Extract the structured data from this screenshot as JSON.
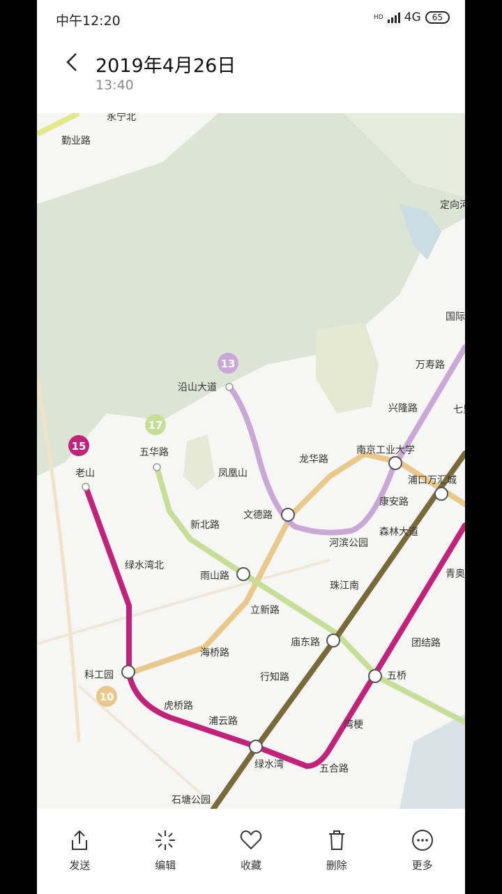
{
  "status": {
    "time": "中午12:20",
    "network": "4G",
    "hd": "HD",
    "battery": "65"
  },
  "header": {
    "title": "2019年4月26日",
    "subtitle": "13:40"
  },
  "map": {
    "line_badges": [
      "13",
      "17",
      "15",
      "10"
    ],
    "stations": {
      "yongning_bei": "永宁北",
      "qinye_lu": "勤业路",
      "dingxiang": "定向河",
      "guoji": "国际",
      "wanshou_lu": "万寿路",
      "xinglong_lu": "兴隆路",
      "qi": "七里",
      "yanshan_dadao": "沿山大道",
      "wuhua_lu": "五华路",
      "laoshan": "老山",
      "fenghuang_shan": "凤凰山",
      "longhua_lu": "龙华路",
      "nanjing_gongye": "南京工业大学",
      "pukou_wanhui": "浦口万汇城",
      "kangan_lu": "康安路",
      "wende_lu": "文德路",
      "xinbei_lu": "新北路",
      "hebin_gongyuan": "河滨公园",
      "senlin_dadao": "森林大道",
      "lvshuiwan_bei": "绿水湾北",
      "yushan_lu": "雨山路",
      "zhujiang_nan": "珠江南",
      "qingao": "青奥",
      "lixin_lu": "立新路",
      "haiqiao_lu": "海桥路",
      "miaodong_lu": "庙东路",
      "tuanjie_lu": "团结路",
      "kegongyuan": "科工园",
      "xingzhi_lu": "行知路",
      "wuqiao": "五桥",
      "huqiao_lu": "虎桥路",
      "puyun_lu": "浦云路",
      "wangeng": "湾梗",
      "lvshuiwan": "绿水湾",
      "wuhe_lu": "五合路",
      "shitang_gongyuan": "石塘公园"
    },
    "colors": {
      "line13": "#c9a8d6",
      "line17": "#c6de98",
      "line15": "#c2237a",
      "line10": "#e9c88b",
      "brown": "#7a6a3a"
    }
  },
  "toolbar": {
    "send": "发送",
    "edit": "编辑",
    "favorite": "收藏",
    "delete": "删除",
    "more": "更多"
  }
}
